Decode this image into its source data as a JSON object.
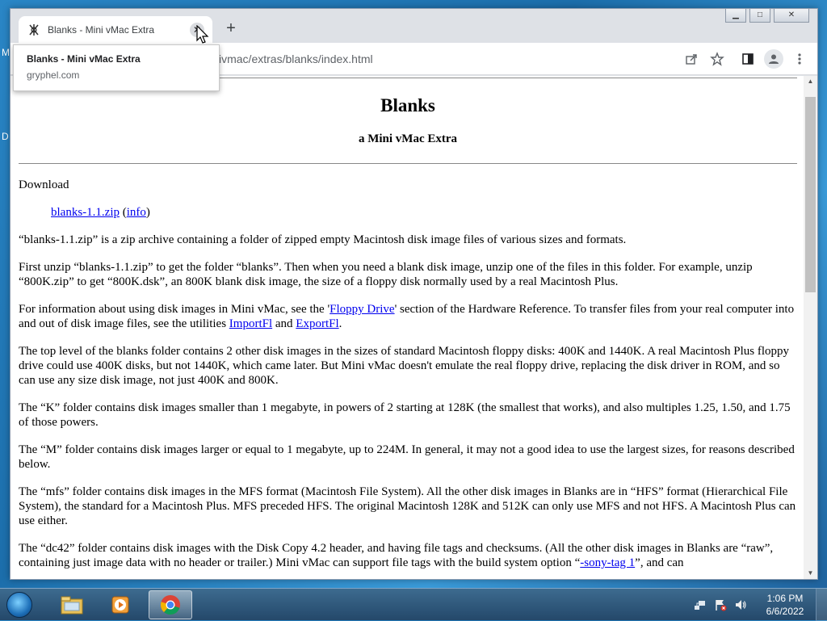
{
  "desktop": {
    "edge_letters": [
      "M",
      "D"
    ]
  },
  "browser": {
    "tab": {
      "title": "Blanks - Mini vMac Extra",
      "close_glyph": "✕"
    },
    "new_tab_glyph": "+",
    "window_controls": {
      "minimize": "▁",
      "maximize": "□",
      "close": "✕"
    },
    "address": {
      "visible_text": "ivmac/extras/blanks/index.html"
    },
    "tooltip": {
      "title": "Blanks - Mini vMac Extra",
      "host": "gryphel.com"
    },
    "toolbar_icons": [
      "share-icon",
      "bookmark-star-icon",
      "side-panel-icon",
      "profile-icon",
      "menu-icon"
    ]
  },
  "page": {
    "title": "Blanks",
    "subtitle": "a Mini vMac Extra",
    "download_label": "Download",
    "download_link": "blanks-1.1.zip",
    "info_link": "info",
    "paragraphs": {
      "p1": "“blanks-1.1.zip” is a zip archive containing a folder of zipped empty Macintosh disk image files of various sizes and formats.",
      "p2": "First unzip “blanks-1.1.zip” to get the folder “blanks”. Then when you need a blank disk image, unzip one of the files in this folder. For example, unzip “800K.zip” to get “800K.dsk”, an 800K blank disk image, the size of a floppy disk normally used by a real Macintosh Plus.",
      "p3_a": "For information about using disk images in Mini vMac, see the '",
      "p3_link1": "Floppy Drive",
      "p3_b": "' section of the Hardware Reference. To transfer files from your real computer into and out of disk image files, see the utilities ",
      "p3_link2": "ImportFl",
      "p3_c": " and ",
      "p3_link3": "ExportFl",
      "p3_d": ".",
      "p4": "The top level of the blanks folder contains 2 other disk images in the sizes of standard Macintosh floppy disks: 400K and 1440K. A real Macintosh Plus floppy drive could use 400K disks, but not 1440K, which came later. But Mini vMac doesn't emulate the real floppy drive, replacing the disk driver in ROM, and so can use any size disk image, not just 400K and 800K.",
      "p5": "The “K” folder contains disk images smaller than 1 megabyte, in powers of 2 starting at 128K (the smallest that works), and also multiples 1.25, 1.50, and 1.75 of those powers.",
      "p6": "The “M” folder contains disk images larger or equal to 1 megabyte, up to 224M. In general, it may not a good idea to use the largest sizes, for reasons described below.",
      "p7": "The “mfs” folder contains disk images in the MFS format (Macintosh File System). All the other disk images in Blanks are in “HFS” format (Hierarchical File System), the standard for a Macintosh Plus. MFS preceded HFS. The original Macintosh 128K and 512K can only use MFS and not HFS. A Macintosh Plus can use either.",
      "p8_a": "The “dc42” folder contains disk images with the Disk Copy 4.2 header, and having file tags and checksums. (All the other disk images in Blanks are “raw”, containing just image data with no header or trailer.) Mini vMac can support file tags with the build system option “",
      "p8_link": "-sony-tag 1",
      "p8_b": "”, and can"
    }
  },
  "taskbar": {
    "apps": [
      "file-explorer-icon",
      "media-player-icon",
      "chrome-icon"
    ],
    "time": "1:06 PM",
    "date": "6/6/2022"
  },
  "colors": {
    "link": "#0000ee",
    "accent_blue": "#1a73e8"
  }
}
